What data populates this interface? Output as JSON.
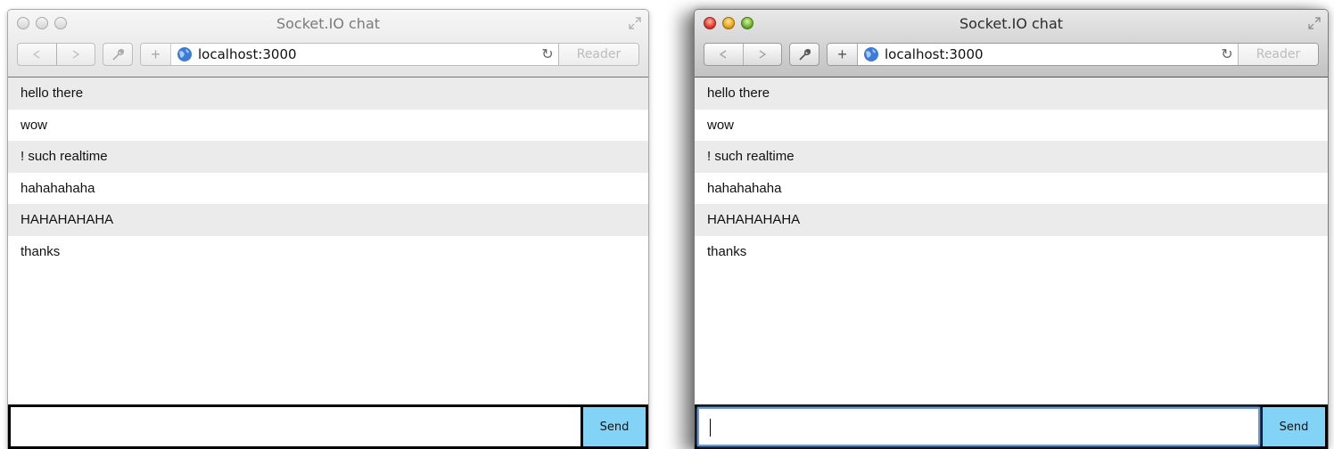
{
  "colors": {
    "send_button": "#82d3f5",
    "message_stripe": "#ebebeb",
    "composer_border": "#000000"
  },
  "windows": [
    {
      "state": "inactive",
      "title": "Socket.IO chat",
      "url": "localhost:3000",
      "reader_label": "Reader",
      "send_label": "Send",
      "input_value": "",
      "messages": [
        "hello there",
        "wow",
        "! such realtime",
        "hahahahaha",
        "HAHAHAHAHA",
        "thanks"
      ]
    },
    {
      "state": "active",
      "title": "Socket.IO chat",
      "url": "localhost:3000",
      "reader_label": "Reader",
      "send_label": "Send",
      "input_value": "",
      "messages": [
        "hello there",
        "wow",
        "! such realtime",
        "hahahahaha",
        "HAHAHAHAHA",
        "thanks"
      ]
    }
  ],
  "icons": [
    "back-arrow-icon",
    "forward-arrow-icon",
    "wrench-icon",
    "plus-icon",
    "globe-icon",
    "reload-icon",
    "fullscreen-icon"
  ]
}
